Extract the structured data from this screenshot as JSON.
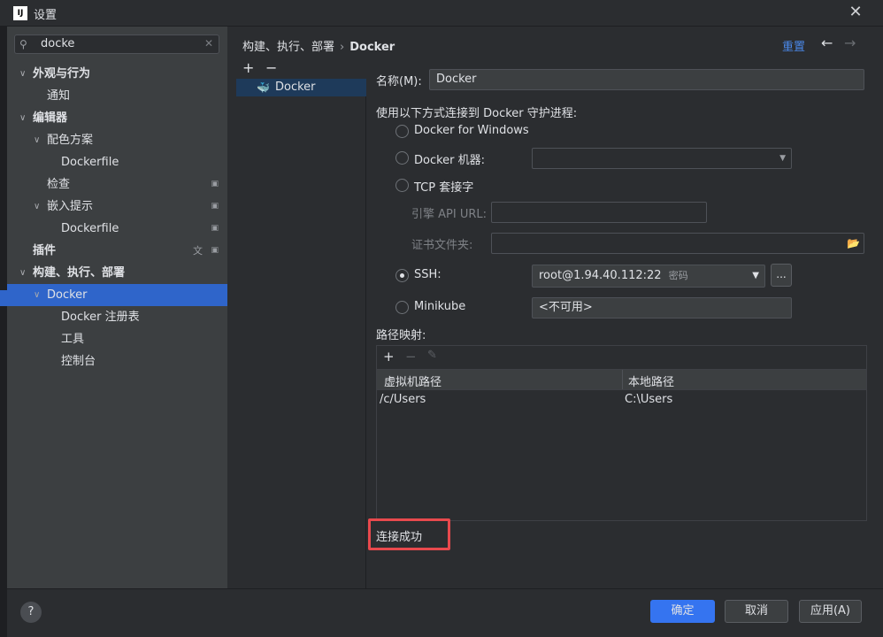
{
  "window": {
    "logo_text": "IJ",
    "title": "设置"
  },
  "sidebar": {
    "search_value": "docke",
    "items": [
      {
        "label": "外观与行为"
      },
      {
        "label": "通知"
      },
      {
        "label": "编辑器"
      },
      {
        "label": "配色方案"
      },
      {
        "label": "Dockerfile"
      },
      {
        "label": "检查"
      },
      {
        "label": "嵌入提示"
      },
      {
        "label": "Dockerfile"
      },
      {
        "label": "插件"
      },
      {
        "label": "构建、执行、部署"
      },
      {
        "label": "Docker"
      },
      {
        "label": "Docker 注册表"
      },
      {
        "label": "工具"
      },
      {
        "label": "控制台"
      }
    ]
  },
  "main": {
    "breadcrumb_parent": "构建、执行、部署",
    "breadcrumb_sep": "›",
    "breadcrumb_current": "Docker",
    "reset_label": "重置",
    "config_item_label": "Docker",
    "name_label": "名称(M):",
    "name_value": "Docker",
    "connect_label": "使用以下方式连接到 Docker 守护进程:",
    "options": {
      "docker_for_windows": "Docker for Windows",
      "docker_machine": "Docker 机器:",
      "tcp_socket": "TCP 套接字",
      "engine_api_url": "引擎 API URL:",
      "cert_folder": "证书文件夹:",
      "ssh": "SSH:",
      "ssh_value": "root@1.94.40.112:22",
      "ssh_suffix": "密码",
      "minikube": "Minikube",
      "minikube_value": "<不可用>"
    },
    "path_mapping_label": "路径映射:",
    "path_table": {
      "columns": [
        "虚拟机路径",
        "本地路径"
      ],
      "rows": [
        {
          "vm": "/c/Users",
          "local": "C:\\Users"
        }
      ]
    },
    "status": "连接成功"
  },
  "footer": {
    "help": "?",
    "ok": "确定",
    "cancel": "取消",
    "apply": "应用(A)"
  }
}
